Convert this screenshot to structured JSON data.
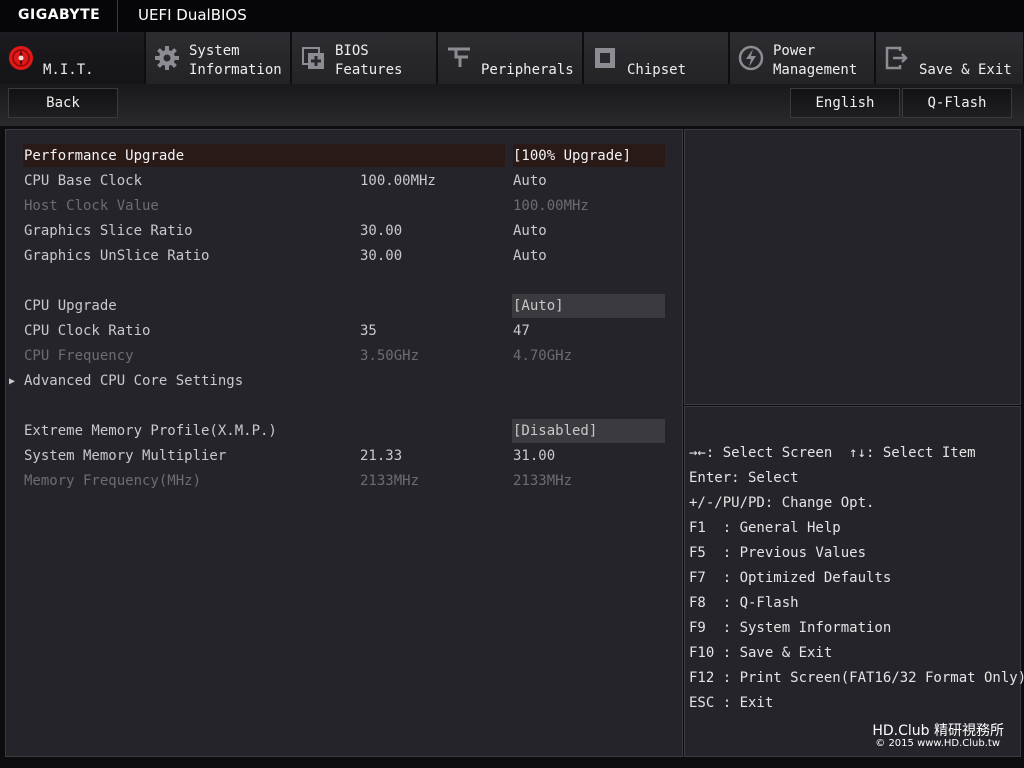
{
  "header": {
    "brand": "GIGABYTE",
    "product": "UEFI DualBIOS"
  },
  "tabs": [
    {
      "label": "M.I.T.",
      "icon": "mit-icon",
      "active": true
    },
    {
      "label": "System\nInformation",
      "icon": "gear-icon"
    },
    {
      "label": "BIOS\nFeatures",
      "icon": "bios-chip-icon"
    },
    {
      "label": "Peripherals",
      "icon": "peripherals-icon"
    },
    {
      "label": "Chipset",
      "icon": "chipset-icon"
    },
    {
      "label": "Power\nManagement",
      "icon": "power-icon"
    },
    {
      "label": "Save & Exit",
      "icon": "exit-icon"
    }
  ],
  "subbar": {
    "back": "Back",
    "language": "English",
    "qflash": "Q-Flash"
  },
  "settings": [
    {
      "label": "Performance Upgrade",
      "v1": "",
      "v2": "[100% Upgrade]",
      "style": "selected"
    },
    {
      "label": "CPU Base Clock",
      "v1": "100.00MHz",
      "v2": "Auto",
      "style": "normal"
    },
    {
      "label": "Host Clock Value",
      "v1": "",
      "v2": "100.00MHz",
      "style": "dim"
    },
    {
      "label": "Graphics Slice Ratio",
      "v1": "30.00",
      "v2": "Auto",
      "style": "normal"
    },
    {
      "label": "Graphics UnSlice Ratio",
      "v1": "30.00",
      "v2": "Auto",
      "style": "normal"
    },
    {
      "label": "CPU Upgrade",
      "v1": "",
      "v2": "[Auto]",
      "style": "normal"
    },
    {
      "label": "CPU Clock Ratio",
      "v1": "35",
      "v2": "47",
      "style": "normal"
    },
    {
      "label": "CPU Frequency",
      "v1": "3.50GHz",
      "v2": "4.70GHz",
      "style": "dim"
    },
    {
      "label": "Advanced CPU Core Settings",
      "v1": "",
      "v2": "",
      "style": "normal"
    },
    {
      "label": "Extreme Memory Profile(X.M.P.)",
      "v1": "",
      "v2": "[Disabled]",
      "style": "normal"
    },
    {
      "label": "System Memory Multiplier",
      "v1": "21.33",
      "v2": "31.00",
      "style": "normal"
    },
    {
      "label": "Memory Frequency(MHz)",
      "v1": "2133MHz",
      "v2": "2133MHz",
      "style": "dim"
    }
  ],
  "keyhelp": [
    "→←: Select Screen  ↑↓: Select Item",
    "Enter: Select",
    "+/-/PU/PD: Change Opt.",
    "F1  : General Help",
    "F5  : Previous Values",
    "F7  : Optimized Defaults",
    "F8  : Q-Flash",
    "F9  : System Information",
    "F10 : Save & Exit",
    "F12 : Print Screen(FAT16/32 Format Only)",
    "ESC : Exit"
  ],
  "watermark": {
    "line1": "HD.Club 精研視務所",
    "line2": "© 2015  www.HD.Club.tw"
  },
  "colors": {
    "accent_red": "#e01818",
    "selected_row_bg": "#2a1a17"
  }
}
